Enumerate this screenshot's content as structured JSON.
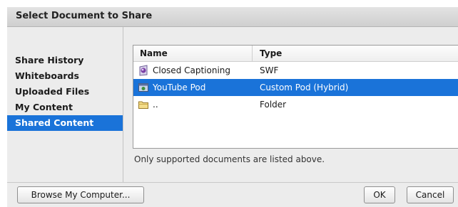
{
  "dialog": {
    "title": "Select Document to Share"
  },
  "sidebar": {
    "items": [
      {
        "label": "Share History"
      },
      {
        "label": "Whiteboards"
      },
      {
        "label": "Uploaded Files"
      },
      {
        "label": "My Content"
      },
      {
        "label": "Shared Content",
        "selected": true
      }
    ]
  },
  "table": {
    "columns": {
      "name": "Name",
      "type": "Type"
    },
    "rows": [
      {
        "name": "Closed Captioning",
        "type": "SWF",
        "icon": "pod-icon"
      },
      {
        "name": "YouTube Pod",
        "type": "Custom Pod (Hybrid)",
        "icon": "custom-pod-icon",
        "selected": true
      },
      {
        "name": "..",
        "type": "Folder",
        "icon": "folder-icon"
      }
    ]
  },
  "note": "Only supported documents are listed above.",
  "buttons": {
    "browse": "Browse My Computer...",
    "ok": "OK",
    "cancel": "Cancel"
  },
  "colors": {
    "selection": "#1a73d9",
    "dialog_bg": "#ececec"
  }
}
